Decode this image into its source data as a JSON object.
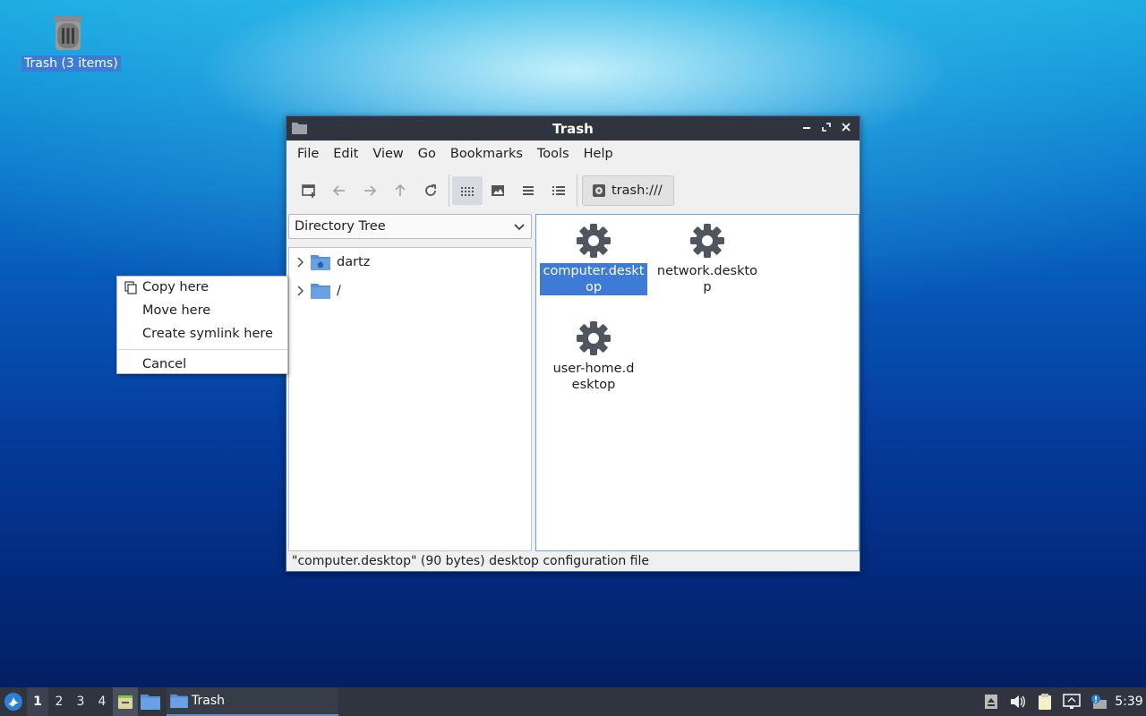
{
  "desktop": {
    "trash_label": "Trash (3 items)"
  },
  "window": {
    "title": "Trash",
    "menu": [
      "File",
      "Edit",
      "View",
      "Go",
      "Bookmarks",
      "Tools",
      "Help"
    ],
    "path": "trash:///",
    "side_pane_mode": "Directory Tree",
    "tree": [
      {
        "label": "dartz",
        "icon": "home-folder-icon"
      },
      {
        "label": "/",
        "icon": "folder-icon"
      }
    ],
    "files": [
      {
        "name": "computer.desktop",
        "icon": "gear-icon",
        "selected": true
      },
      {
        "name": "network.desktop",
        "icon": "gear-icon",
        "selected": false
      },
      {
        "name": "user-home.desktop",
        "icon": "gear-icon",
        "selected": false
      }
    ],
    "status": "\"computer.desktop\" (90 bytes) desktop configuration file"
  },
  "context_menu": {
    "items": [
      "Copy here",
      "Move here",
      "Create symlink here"
    ],
    "cancel": "Cancel"
  },
  "taskbar": {
    "workspaces": [
      "1",
      "2",
      "3",
      "4"
    ],
    "active_workspace": "1",
    "task_label": "Trash",
    "clock": "5:39"
  },
  "colors": {
    "selection": "#3d7bd6",
    "titlebar": "#2f343f",
    "taskbar": "#2f343f"
  }
}
